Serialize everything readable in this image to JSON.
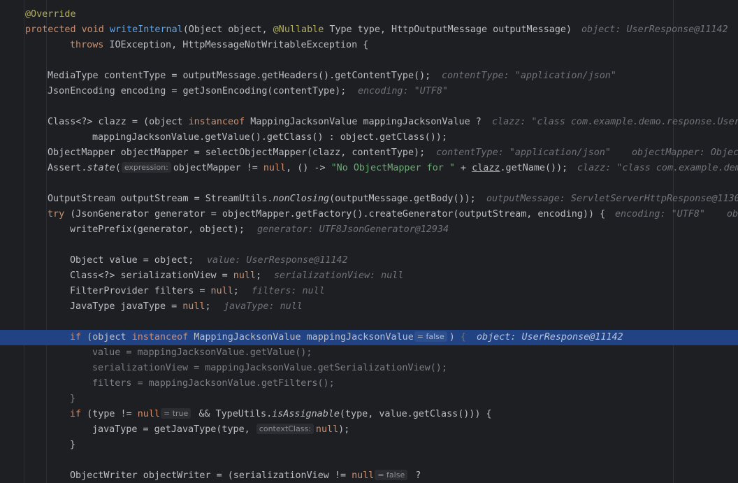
{
  "editor": {
    "language": "Java",
    "theme_colors": {
      "background": "#1e1f22",
      "keyword": "#cf8e6d",
      "function": "#56a8f5",
      "string": "#6aab73",
      "annotation": "#b3ae60",
      "inline_hint": "#6f737a",
      "execution_line": "#214283"
    },
    "lines": {
      "l1": {
        "anno": "@Override"
      },
      "l2": {
        "kw": "protected void ",
        "fn": "writeInternal",
        "p1": "(Object object, ",
        "anno": "@Nullable",
        "p2": " Type type, HttpOutputMessage outputMessage)",
        "hint": "object: UserResponse@11142"
      },
      "l3": {
        "kw": "throws",
        "rest": " IOException, HttpMessageNotWritableException {"
      },
      "l5": {
        "code": "MediaType contentType = outputMessage.getHeaders().getContentType();",
        "hint": "contentType: \"application/json\""
      },
      "l6": {
        "code": "JsonEncoding encoding = getJsonEncoding(contentType);",
        "hint": "encoding: \"UTF8\""
      },
      "l8": {
        "p1": "Class<?> clazz = (object ",
        "kw": "instanceof",
        "p2": " MappingJacksonValue mappingJacksonValue ?",
        "hint": "clazz: \"class com.example.demo.response.User"
      },
      "l9": {
        "code": "mappingJacksonValue.getValue().getClass() : object.getClass());"
      },
      "l10": {
        "code": "ObjectMapper objectMapper = selectObjectMapper(clazz, contentType);",
        "hint1": "contentType: \"application/json\"",
        "hint2": "objectMapper: Objec"
      },
      "l11": {
        "p1": "Assert.",
        "method": "state",
        "p2": "(",
        "pill": "expression:",
        "p3": "objectMapper != ",
        "null_kw": "null",
        "p4": ", () -> ",
        "str": "\"No ObjectMapper for \"",
        "p5": " + ",
        "clazz": "clazz",
        "p6": ".getName());",
        "hint": "clazz: \"class com.example.dem"
      },
      "l13": {
        "p1": "OutputStream outputStream = StreamUtils.",
        "method": "nonClosing",
        "p2": "(outputMessage.getBody());",
        "hint": "outputMessage: ServletServerHttpResponse@1130"
      },
      "l14": {
        "kw": "try",
        "code": " (JsonGenerator generator = objectMapper.getFactory().createGenerator(outputStream, encoding)) {",
        "hint1": "encoding: \"UTF8\"",
        "hint2": "ob"
      },
      "l15": {
        "code": "writePrefix(generator, object);",
        "hint": "generator: UTF8JsonGenerator@12934"
      },
      "l17": {
        "code": "Object value = object;",
        "hint": "value: UserResponse@11142"
      },
      "l18": {
        "p1": "Class<?> serializationView = ",
        "null_kw": "null",
        "p2": ";",
        "hint": "serializationView: null"
      },
      "l19": {
        "p1": "FilterProvider filters = ",
        "null_kw": "null",
        "p2": ";",
        "hint": "filters: null"
      },
      "l20": {
        "p1": "JavaType javaType = ",
        "null_kw": "null",
        "p2": ";",
        "hint": "javaType: null"
      },
      "l22": {
        "kw_if": "if",
        "p1": " (object ",
        "kw_inst": "instanceof",
        "p2": " MappingJacksonValue mappingJacksonValue",
        "pill": "= false",
        "p3": ") ",
        "brace": "{",
        "hint": "object: UserResponse@11142"
      },
      "l23": {
        "code": "value = mappingJacksonValue.getValue();"
      },
      "l24": {
        "code": "serializationView = mappingJacksonValue.getSerializationView();"
      },
      "l25": {
        "code": "filters = mappingJacksonValue.getFilters();"
      },
      "l26": {
        "code": "}"
      },
      "l27": {
        "kw_if": "if",
        "p1": " (type != ",
        "null_kw": "null",
        "pill": "= true",
        "p2": " && TypeUtils.",
        "method": "isAssignable",
        "p3": "(type, value.getClass())) {"
      },
      "l28": {
        "p1": "javaType = getJavaType(type, ",
        "pill": "contextClass:",
        "null_kw": "null",
        "p2": ");"
      },
      "l29": {
        "code": "}"
      },
      "l31": {
        "p1": "ObjectWriter objectWriter = (serializationView != ",
        "null_kw": "null",
        "pill": "= false",
        "p2": " ?"
      }
    }
  }
}
